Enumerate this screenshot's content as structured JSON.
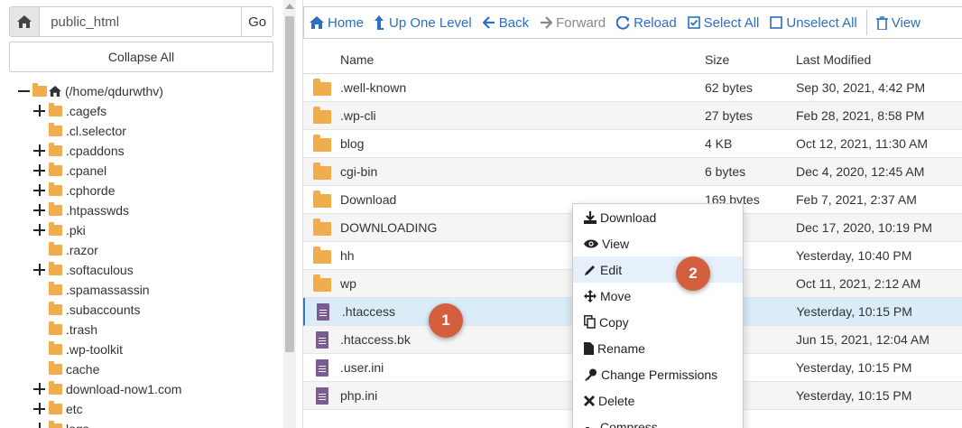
{
  "left": {
    "path_value": "public_html",
    "go_label": "Go",
    "collapse_label": "Collapse All",
    "root_label": "(/home/qdurwthv)",
    "tree": [
      {
        "label": ".cagefs",
        "expandable": true
      },
      {
        "label": ".cl.selector",
        "expandable": false
      },
      {
        "label": ".cpaddons",
        "expandable": true
      },
      {
        "label": ".cpanel",
        "expandable": true
      },
      {
        "label": ".cphorde",
        "expandable": true
      },
      {
        "label": ".htpasswds",
        "expandable": true
      },
      {
        "label": ".pki",
        "expandable": true
      },
      {
        "label": ".razor",
        "expandable": false
      },
      {
        "label": ".softaculous",
        "expandable": true
      },
      {
        "label": ".spamassassin",
        "expandable": false
      },
      {
        "label": ".subaccounts",
        "expandable": false
      },
      {
        "label": ".trash",
        "expandable": false
      },
      {
        "label": ".wp-toolkit",
        "expandable": false
      },
      {
        "label": "cache",
        "expandable": false
      },
      {
        "label": "download-now1.com",
        "expandable": true
      },
      {
        "label": "etc",
        "expandable": true
      },
      {
        "label": "logs",
        "expandable": true
      }
    ]
  },
  "toolbar": {
    "home": "Home",
    "up": "Up One Level",
    "back": "Back",
    "forward": "Forward",
    "reload": "Reload",
    "select_all": "Select All",
    "unselect_all": "Unselect All",
    "view": "View"
  },
  "table": {
    "headers": {
      "name": "Name",
      "size": "Size",
      "modified": "Last Modified"
    },
    "rows": [
      {
        "type": "folder",
        "name": ".well-known",
        "size": "62 bytes",
        "modified": "Sep 30, 2021, 4:42 PM"
      },
      {
        "type": "folder",
        "name": ".wp-cli",
        "size": "27 bytes",
        "modified": "Feb 28, 2021, 8:58 PM"
      },
      {
        "type": "folder",
        "name": "blog",
        "size": "4 KB",
        "modified": "Oct 12, 2021, 11:30 AM"
      },
      {
        "type": "folder",
        "name": "cgi-bin",
        "size": "6 bytes",
        "modified": "Dec 4, 2020, 12:45 AM"
      },
      {
        "type": "folder",
        "name": "Download",
        "size": "169 bytes",
        "modified": "Feb 7, 2021, 2:37 AM"
      },
      {
        "type": "folder",
        "name": "DOWNLOADING",
        "size": "tes",
        "modified": "Dec 17, 2020, 10:19 PM"
      },
      {
        "type": "folder",
        "name": "hh",
        "size": "",
        "modified": "Yesterday, 10:40 PM"
      },
      {
        "type": "folder",
        "name": "wp",
        "size": "",
        "modified": "Oct 11, 2021, 2:12 AM"
      },
      {
        "type": "file",
        "name": ".htaccess",
        "size": "B",
        "modified": "Yesterday, 10:15 PM"
      },
      {
        "type": "file",
        "name": ".htaccess.bk",
        "size": "tes",
        "modified": "Jun 15, 2021, 12:04 AM"
      },
      {
        "type": "file",
        "name": ".user.ini",
        "size": "tes",
        "modified": "Yesterday, 10:15 PM"
      },
      {
        "type": "file",
        "name": "php.ini",
        "size": "tes",
        "modified": "Yesterday, 10:15 PM"
      }
    ]
  },
  "context_menu": {
    "items": [
      "Download",
      "View",
      "Edit",
      "Move",
      "Copy",
      "Rename",
      "Change Permissions",
      "Delete",
      "Compress"
    ]
  },
  "markers": {
    "one": "1",
    "two": "2"
  },
  "colors": {
    "accent": "#2a6fc2",
    "folder": "#f0ad4e",
    "file": "#7a5c93",
    "marker": "#d35f3f",
    "selected_row": "#d9ecf8"
  }
}
